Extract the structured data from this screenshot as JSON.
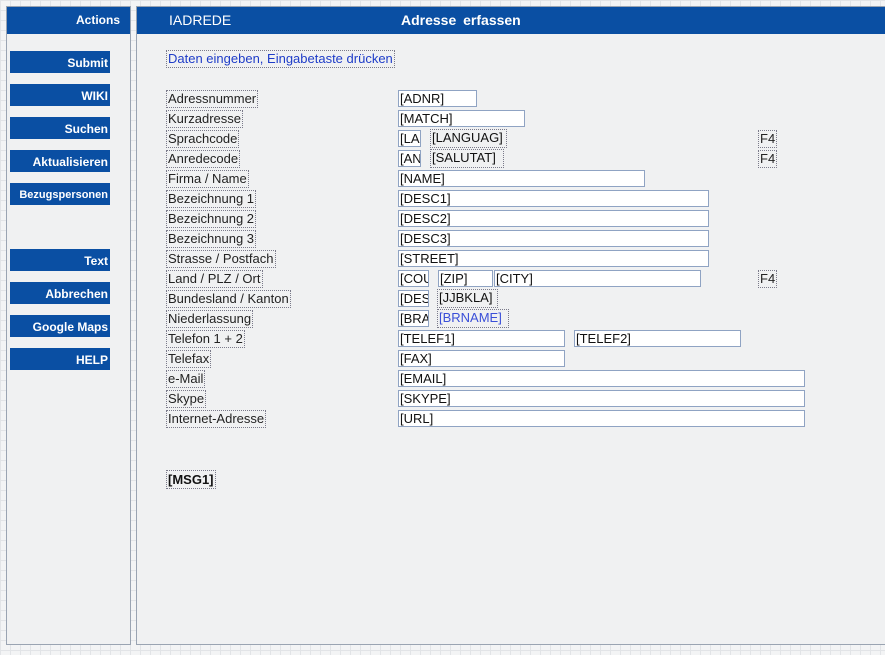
{
  "sidebar": {
    "title": "Actions",
    "buttons": [
      "Submit",
      "WIKI",
      "Suchen",
      "Aktualisieren",
      "Bezugspersonen",
      "Text",
      "Abbrechen",
      "Google Maps",
      "HELP"
    ]
  },
  "header": {
    "program": "IADREDE",
    "title": "Adresse erfassen"
  },
  "instruction": "Daten eingeben, Eingabetaste drücken",
  "labels": {
    "adnr": "Adressnummer",
    "match": "Kurzadresse",
    "sprachcode": "Sprachcode",
    "anrede": "Anredecode",
    "firma": "Firma / Name",
    "desc1": "Bezeichnung 1",
    "desc2": "Bezeichnung 2",
    "desc3": "Bezeichnung 3",
    "street": "Strasse / Postfach",
    "land": "Land / PLZ / Ort",
    "bundesland": "Bundesland / Kanton",
    "niederlassung": "Niederlassung",
    "telefon": "Telefon 1 + 2",
    "telefax": "Telefax",
    "email": "e-Mail",
    "skype": "Skype",
    "url": "Internet-Adresse"
  },
  "fields": {
    "adnr": "[ADNR]",
    "match": "[MATCH]",
    "lang_code": "[LA",
    "language": "[LANGUAG]",
    "anrede_code": "[AN",
    "salutat": "[SALUTAT]",
    "name": "[NAME]",
    "desc1": "[DESC1]",
    "desc2": "[DESC2]",
    "desc3": "[DESC3]",
    "street": "[STREET]",
    "country": "[COU",
    "zip": "[ZIP]",
    "city": "[CITY]",
    "bundesland_code": "[DES",
    "jjbkla": "[JJBKLA]",
    "branch_code": "[BRA",
    "brname": "[BRNAME]",
    "telef1": "[TELEF1]",
    "telef2": "[TELEF2]",
    "fax": "[FAX]",
    "email": "[EMAIL]",
    "skype": "[SKYPE]",
    "url": "[URL]"
  },
  "prompt_key": "F4",
  "message": "[MSG1]"
}
